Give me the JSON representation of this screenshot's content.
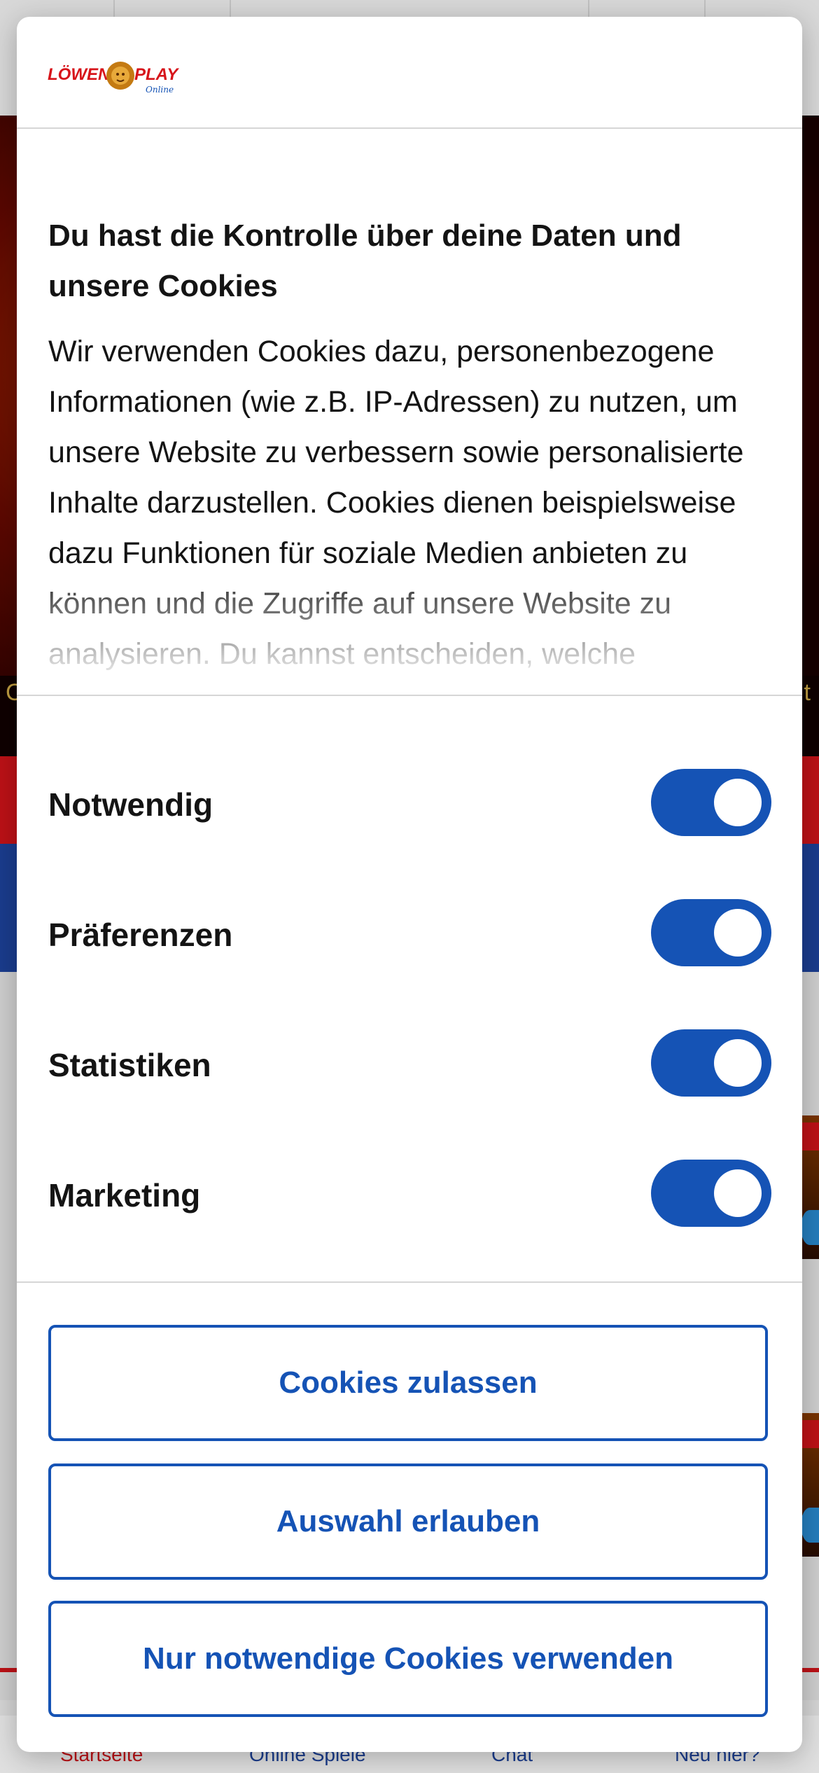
{
  "brand": {
    "logo_word_left": "LÖWEN",
    "logo_word_right": "PLAY",
    "logo_sub": "Online",
    "primary_color": "#1553b5",
    "brand_red": "#d7141a"
  },
  "consent": {
    "title": "Du hast die Kontrolle über deine Daten und unsere Cookies",
    "description": "Wir verwenden Cookies dazu, personenbezogene Informationen (wie z.B. IP-Adressen) zu nutzen, um unsere Website zu verbessern sowie personalisierte Inhalte darzustellen. Cookies dienen beispielsweise dazu Funktionen für soziale Medien anbieten zu können und die Zugriffe auf unsere Website zu analysieren. Du kannst entscheiden, welche",
    "toggles": [
      {
        "label": "Notwendig",
        "on": true
      },
      {
        "label": "Präferenzen",
        "on": true
      },
      {
        "label": "Statistiken",
        "on": true
      },
      {
        "label": "Marketing",
        "on": true
      }
    ],
    "buttons": {
      "allow_all": "Cookies zulassen",
      "allow_selection": "Auswahl erlauben",
      "necessary_only": "Nur notwendige Cookies verwenden"
    }
  },
  "bottom_nav": {
    "items": [
      "Startseite",
      "Online Spiele",
      "Chat",
      "Neu hier?"
    ]
  }
}
